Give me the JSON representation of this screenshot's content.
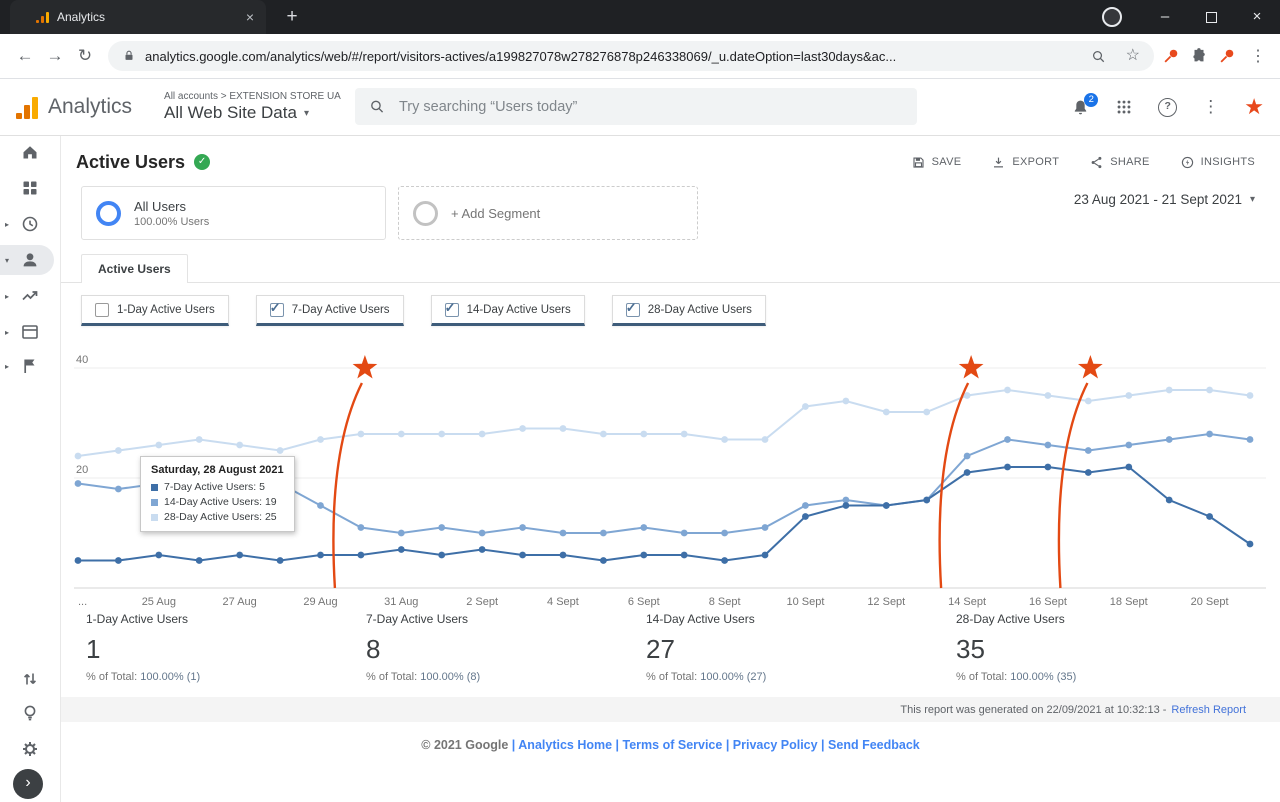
{
  "browser": {
    "tab_title": "Analytics",
    "url": "analytics.google.com/analytics/web/#/report/visitors-actives/a199827078w278276878p246338069/_u.dateOption=last30days&ac..."
  },
  "header": {
    "product": "Analytics",
    "breadcrumb": "All accounts > EXTENSION STORE UA",
    "property": "All Web Site Data",
    "search_placeholder": "Try searching “Users today”",
    "notifications": "2"
  },
  "sidebar": {
    "items": [
      "home",
      "customization",
      "realtime",
      "audience",
      "acquisition",
      "behavior",
      "conversions",
      "attribution",
      "discover",
      "admin"
    ],
    "selected": "audience"
  },
  "report": {
    "title": "Active Users",
    "actions": [
      "SAVE",
      "EXPORT",
      "SHARE",
      "INSIGHTS"
    ],
    "segment": {
      "name": "All Users",
      "detail": "100.00% Users"
    },
    "add_segment_label": "+ Add Segment",
    "date_range": "23 Aug 2021 - 21 Sept 2021",
    "tab_label": "Active Users",
    "toggles": [
      {
        "label": "1-Day Active Users",
        "checked": false
      },
      {
        "label": "7-Day Active Users",
        "checked": true
      },
      {
        "label": "14-Day Active Users",
        "checked": true
      },
      {
        "label": "28-Day Active Users",
        "checked": true
      }
    ],
    "summary": [
      {
        "label": "1-Day Active Users",
        "value": "1",
        "pct_label": "% of Total:",
        "pct_value": "100.00% (1)"
      },
      {
        "label": "7-Day Active Users",
        "value": "8",
        "pct_label": "% of Total:",
        "pct_value": "100.00% (8)"
      },
      {
        "label": "14-Day Active Users",
        "value": "27",
        "pct_label": "% of Total:",
        "pct_value": "100.00% (27)"
      },
      {
        "label": "28-Day Active Users",
        "value": "35",
        "pct_label": "% of Total:",
        "pct_value": "100.00% (35)"
      }
    ],
    "generated_text": "This report was generated on 22/09/2021 at 10:32:13 -",
    "refresh_label": "Refresh Report"
  },
  "tooltip": {
    "title": "Saturday, 28 August 2021",
    "rows": [
      {
        "swatch": "#3e6fa7",
        "text": "7-Day Active Users: 5"
      },
      {
        "swatch": "#7fa6d3",
        "text": "14-Day Active Users: 19"
      },
      {
        "swatch": "#c9dcf0",
        "text": "28-Day Active Users: 25"
      }
    ]
  },
  "chart_data": {
    "type": "line",
    "x": [
      "23 Aug",
      "24 Aug",
      "25 Aug",
      "26 Aug",
      "27 Aug",
      "28 Aug",
      "29 Aug",
      "30 Aug",
      "31 Aug",
      "1 Sept",
      "2 Sept",
      "3 Sept",
      "4 Sept",
      "5 Sept",
      "6 Sept",
      "7 Sept",
      "8 Sept",
      "9 Sept",
      "10 Sept",
      "11 Sept",
      "12 Sept",
      "13 Sept",
      "14 Sept",
      "15 Sept",
      "16 Sept",
      "17 Sept",
      "18 Sept",
      "19 Sept",
      "20 Sept",
      "21 Sept"
    ],
    "x_ticks": [
      {
        "index": 0,
        "label": "..."
      },
      {
        "index": 2,
        "label": "25 Aug"
      },
      {
        "index": 4,
        "label": "27 Aug"
      },
      {
        "index": 6,
        "label": "29 Aug"
      },
      {
        "index": 8,
        "label": "31 Aug"
      },
      {
        "index": 10,
        "label": "2 Sept"
      },
      {
        "index": 12,
        "label": "4 Sept"
      },
      {
        "index": 14,
        "label": "6 Sept"
      },
      {
        "index": 16,
        "label": "8 Sept"
      },
      {
        "index": 18,
        "label": "10 Sept"
      },
      {
        "index": 20,
        "label": "12 Sept"
      },
      {
        "index": 22,
        "label": "14 Sept"
      },
      {
        "index": 24,
        "label": "16 Sept"
      },
      {
        "index": 26,
        "label": "18 Sept"
      },
      {
        "index": 28,
        "label": "20 Sept"
      }
    ],
    "yticks": [
      20,
      40
    ],
    "ylim": [
      0,
      44
    ],
    "series": [
      {
        "name": "7-Day Active Users",
        "color": "#3e6fa7",
        "values": [
          5,
          5,
          6,
          5,
          6,
          5,
          6,
          6,
          7,
          6,
          7,
          6,
          6,
          5,
          6,
          6,
          5,
          6,
          13,
          15,
          15,
          16,
          21,
          22,
          22,
          21,
          22,
          16,
          13,
          8
        ]
      },
      {
        "name": "14-Day Active Users",
        "color": "#7fa6d3",
        "values": [
          19,
          18,
          19,
          20,
          19,
          19,
          15,
          11,
          10,
          11,
          10,
          11,
          10,
          10,
          11,
          10,
          10,
          11,
          15,
          16,
          15,
          16,
          24,
          27,
          26,
          25,
          26,
          27,
          28,
          27
        ]
      },
      {
        "name": "28-Day Active Users",
        "color": "#c9dcf0",
        "values": [
          24,
          25,
          26,
          27,
          26,
          25,
          27,
          28,
          28,
          28,
          28,
          29,
          29,
          28,
          28,
          28,
          27,
          27,
          33,
          34,
          32,
          32,
          35,
          36,
          35,
          34,
          35,
          36,
          36,
          35
        ]
      }
    ],
    "annotation_color": "#e34913",
    "annotations": [
      {
        "x_index": 7.1
      },
      {
        "x_index": 22.1
      },
      {
        "x_index": 25.05
      }
    ]
  },
  "footer": {
    "copyright": "© 2021 Google",
    "separator": "|",
    "links": [
      "Analytics Home",
      "Terms of Service",
      "Privacy Policy",
      "Send Feedback"
    ]
  },
  "colors": {
    "accent_blue": "#4285f4",
    "ga_orange": "#f9ab00",
    "ga_orange_dark": "#e37400",
    "green_check": "#34a853",
    "badge_blue": "#1a73e8",
    "annotation": "#e34913",
    "extension_pin": "#e8491d"
  },
  "icons": {
    "back": "←",
    "forward": "→",
    "reload": "↻",
    "bookmark_star": "☆",
    "menu_kebab": "⋮",
    "caret_down": "▾",
    "caret_right": "▸",
    "check": "✓",
    "close": "×",
    "new_tab": "+",
    "minimize": "–",
    "avatar_star": "★",
    "help": "?",
    "expand": "›"
  }
}
